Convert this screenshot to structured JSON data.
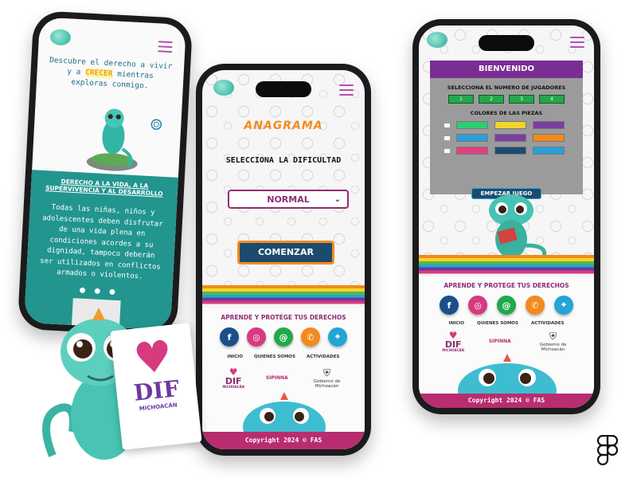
{
  "phone_left": {
    "intro_pre": "Descubre el derecho a vivir y a",
    "intro_highlight": "CRECER",
    "intro_post": "mientras exploras conmigo.",
    "right_title": "DERECHO A LA VIDA, A LA SUPERVIVENCIA Y AL DESARROLLO",
    "body": "Todas las niñas, niños y adolescentes deben disfrutar de una vida plena en condiciones acordes a su dignidad, tampoco deberán ser utilizados en conflictos armados o violentos.",
    "dots": "● ● ●"
  },
  "phone_middle": {
    "title": "ANAGRAMA",
    "subtitle": "SELECCIONA LA DIFICULTAD",
    "difficulty": "NORMAL",
    "start_button": "COMENZAR"
  },
  "phone_right": {
    "header": "BIENVENIDO",
    "players_label": "SELECCIONA EL NUMERO DE JUGADORES",
    "players": [
      "1",
      "2",
      "3",
      "4"
    ],
    "colors_label": "COLORES DE LAS PIEZAS",
    "color_rows": [
      [
        "#2ecc71",
        "#f1d42b",
        "#7b3fa0"
      ],
      [
        "#2b9fd9",
        "#7b3fa0",
        "#f28a1c"
      ],
      [
        "#e0407f",
        "#1d4b6e",
        "#2b9fd9"
      ]
    ],
    "start_button": "EMPEZAR JUEGO"
  },
  "common": {
    "protect_title": "APRENDE Y PROTEGE TUS DERECHOS",
    "nav": [
      "INICIO",
      "QUIENES SOMOS",
      "ACTIVIDADES"
    ],
    "copyright": "Copyright 2024 © FAS",
    "logo_dif": "DIF",
    "logo_dif_sub": "MICHOACÁN",
    "logo_sipinna": "SIPINNA",
    "logo_gov": "Gobierno de Michoacán"
  },
  "social": [
    {
      "icon": "facebook-icon",
      "glyph": "f",
      "color": "#1b4f8a"
    },
    {
      "icon": "instagram-icon",
      "glyph": "◎",
      "color": "#d63a7f"
    },
    {
      "icon": "whatsapp-icon",
      "glyph": "@",
      "color": "#22a84a"
    },
    {
      "icon": "phone-icon",
      "glyph": "✆",
      "color": "#f28a1c"
    },
    {
      "icon": "location-icon",
      "glyph": "⌖",
      "color": "#23a5d6"
    }
  ],
  "brand": {
    "card_logo": "DIF",
    "card_sub": "MICHOACÁN",
    "figma_icon": "figma-icon"
  }
}
